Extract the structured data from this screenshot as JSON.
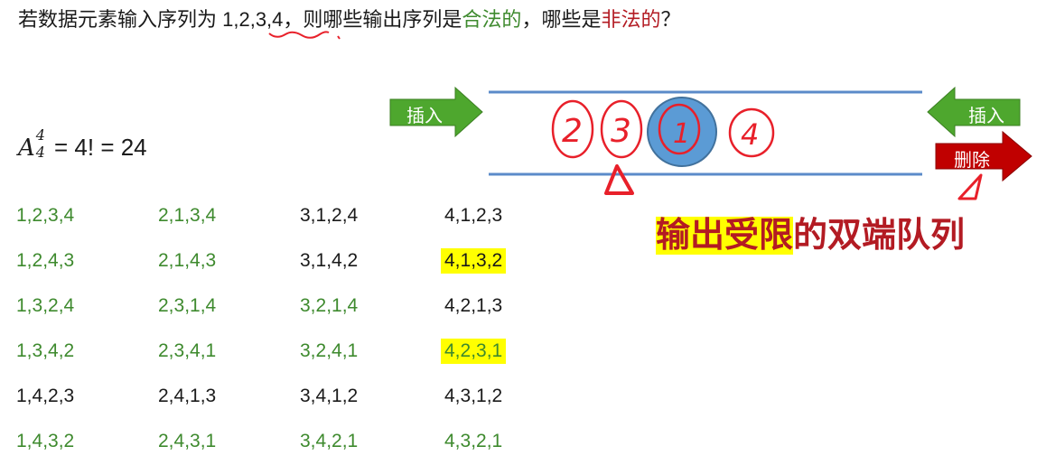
{
  "question": {
    "prefix": "若数据元素输入序列为 ",
    "sequence": "1,2,3,4",
    "middle": "，则哪些输出序列是",
    "legal": "合法的",
    "middle2": "，哪些是",
    "illegal": "非法的",
    "suffix": "？"
  },
  "formula": {
    "symbol": "A",
    "superscript": "4",
    "subscript": "4",
    "rest": " = 4! = 24"
  },
  "permutations": [
    {
      "text": "1,2,3,4",
      "legal": true,
      "highlight": false
    },
    {
      "text": "2,1,3,4",
      "legal": true,
      "highlight": false
    },
    {
      "text": "3,1,2,4",
      "legal": false,
      "highlight": false
    },
    {
      "text": "4,1,2,3",
      "legal": false,
      "highlight": false
    },
    {
      "text": "1,2,4,3",
      "legal": true,
      "highlight": false
    },
    {
      "text": "2,1,4,3",
      "legal": true,
      "highlight": false
    },
    {
      "text": "3,1,4,2",
      "legal": false,
      "highlight": false
    },
    {
      "text": "4,1,3,2",
      "legal": false,
      "highlight": true
    },
    {
      "text": "1,3,2,4",
      "legal": true,
      "highlight": false
    },
    {
      "text": "2,3,1,4",
      "legal": true,
      "highlight": false
    },
    {
      "text": "3,2,1,4",
      "legal": true,
      "highlight": false
    },
    {
      "text": "4,2,1,3",
      "legal": false,
      "highlight": false
    },
    {
      "text": "1,3,4,2",
      "legal": true,
      "highlight": false
    },
    {
      "text": "2,3,4,1",
      "legal": true,
      "highlight": false
    },
    {
      "text": "3,2,4,1",
      "legal": true,
      "highlight": false
    },
    {
      "text": "4,2,3,1",
      "legal": true,
      "highlight": true
    },
    {
      "text": "1,4,2,3",
      "legal": false,
      "highlight": false
    },
    {
      "text": "2,4,1,3",
      "legal": false,
      "highlight": false
    },
    {
      "text": "3,4,1,2",
      "legal": false,
      "highlight": false
    },
    {
      "text": "4,3,1,2",
      "legal": false,
      "highlight": false
    },
    {
      "text": "1,4,3,2",
      "legal": true,
      "highlight": false
    },
    {
      "text": "2,4,3,1",
      "legal": true,
      "highlight": false
    },
    {
      "text": "3,4,2,1",
      "legal": true,
      "highlight": false
    },
    {
      "text": "4,3,2,1",
      "legal": true,
      "highlight": false
    }
  ],
  "diagram": {
    "insert_left": "插入",
    "insert_right": "插入",
    "delete_right": "删除",
    "handwritten_digits": [
      "2",
      "3",
      "1",
      "4"
    ]
  },
  "deque_title": {
    "highlighted": "输出受限",
    "rest": "的双端队列"
  },
  "colors": {
    "legal": "#3e8a2e",
    "illegal": "#b31b23",
    "highlight": "#ffff00",
    "arrow_green": "#4ea72e",
    "arrow_red": "#c00000",
    "queue_line": "#5b8bc9",
    "ball": "#5b9bd5",
    "ink": "#e8202a"
  }
}
